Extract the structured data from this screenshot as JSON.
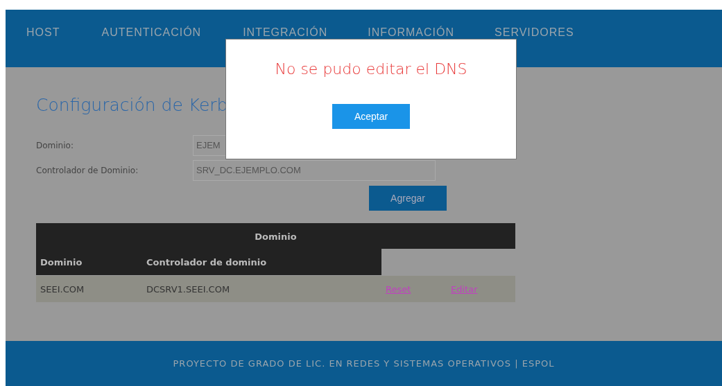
{
  "nav": {
    "items": [
      {
        "label": "HOST"
      },
      {
        "label": "AUTENTICACIÓN"
      },
      {
        "label": "INTEGRACIÓN"
      },
      {
        "label": "INFORMACIÓN"
      },
      {
        "label": "SERVIDORES"
      }
    ]
  },
  "page": {
    "title": "Configuración de Kerb",
    "fields": [
      {
        "label": "Dominio:",
        "value": "EJEM"
      },
      {
        "label": "Controlador de Dominio:",
        "value": "SRV_DC.EJEMPLO.COM"
      }
    ],
    "add_button": "Agregar"
  },
  "table": {
    "group_header": "Dominio",
    "columns": [
      "Dominio",
      "Controlador de dominio"
    ],
    "rows": [
      {
        "cells": [
          "SEEI.COM",
          "DCSRV1.SEEI.COM"
        ],
        "links": [
          "Reset",
          "Editar"
        ]
      }
    ]
  },
  "footer": "PROYECTO DE GRADO DE LIC. EN REDES Y SISTEMAS OPERATIVOS | ESPOL",
  "dialog": {
    "message": "No se pudo editar el DNS",
    "button": "Aceptar"
  }
}
